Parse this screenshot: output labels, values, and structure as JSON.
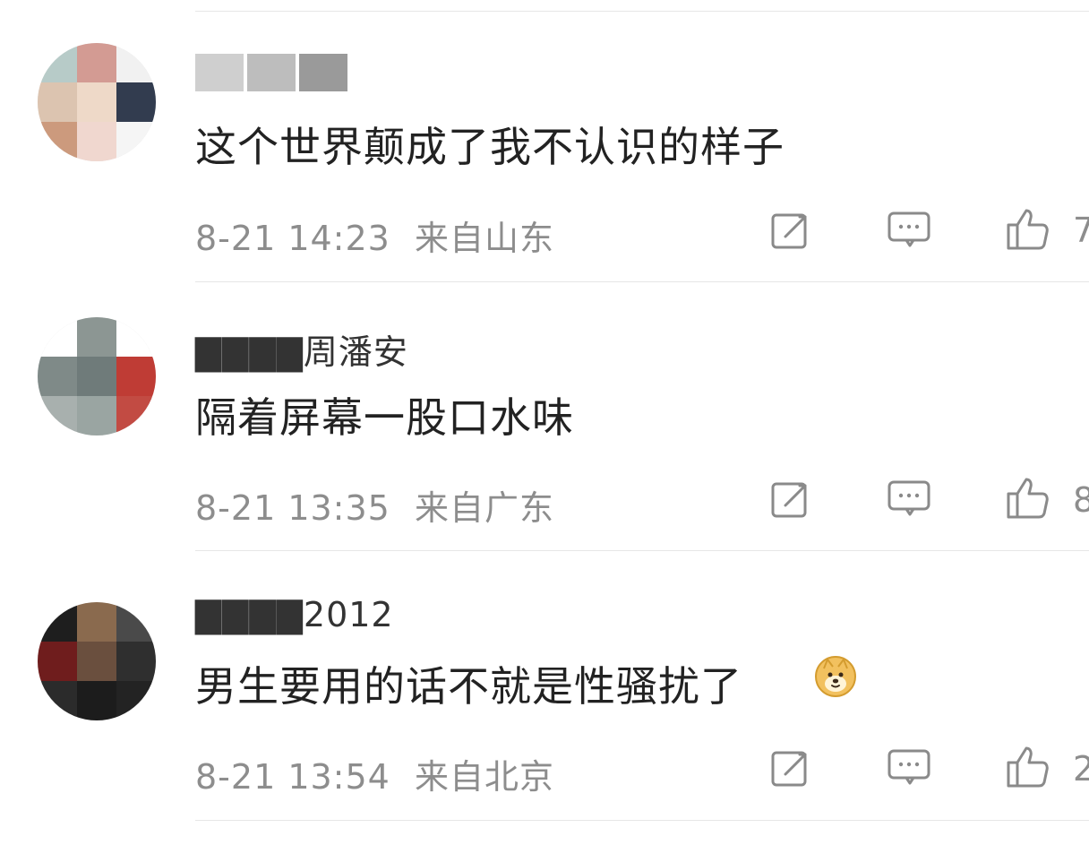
{
  "comments": [
    {
      "username": "▇▇▇▇▇▇",
      "text": "这个世界颠成了我不认识的样子",
      "date": "8-21 14:23",
      "location": "来自山东",
      "like_count_partial": "7"
    },
    {
      "username": "▇▇▇▇周潘安",
      "text": "隔着屏幕一股口水味",
      "date": "8-21 13:35",
      "location": "来自广东",
      "like_count_partial": "8"
    },
    {
      "username": "▇▇▇▇2012",
      "text": "男生要用的话不就是性骚扰了",
      "date": "8-21 13:54",
      "location": "来自北京",
      "like_count_partial": "2"
    }
  ],
  "icons": {
    "repost": "edit-square-icon",
    "comment": "comment-bubble-icon",
    "like": "thumbs-up-icon",
    "emoji": "doge-emoji-icon"
  },
  "colors": {
    "text_primary": "#222222",
    "text_secondary": "#8d8d8d",
    "divider": "#e6e6e6",
    "icon_gray": "#8a8a8a"
  }
}
